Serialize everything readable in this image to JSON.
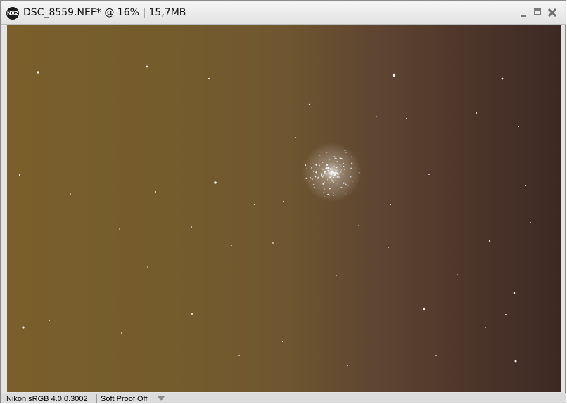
{
  "window": {
    "title": "DSC_8559.NEF* @ 16% | 15,7MB",
    "app_logo_text": "NX2",
    "icons": [
      "app-logo-icon",
      "minimize-icon",
      "maximize-icon",
      "close-icon"
    ]
  },
  "statusbar": {
    "color_profile": "Nikon sRGB 4.0.0.3002",
    "soft_proof": "Soft Proof Off"
  },
  "image": {
    "content": "astrophoto-starfield-with-globular-cluster",
    "background_colors": [
      "#7a5f2b",
      "#6f5630",
      "#3d2a24"
    ]
  }
}
